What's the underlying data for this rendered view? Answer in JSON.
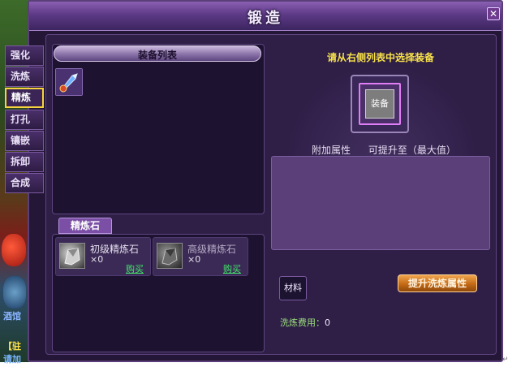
{
  "window": {
    "title": "锻造",
    "close_icon": "close-icon"
  },
  "tabs": [
    {
      "label": "强化",
      "active": false
    },
    {
      "label": "洗炼",
      "active": false
    },
    {
      "label": "精炼",
      "active": true
    },
    {
      "label": "打孔",
      "active": false
    },
    {
      "label": "镶嵌",
      "active": false
    },
    {
      "label": "拆卸",
      "active": false
    },
    {
      "label": "合成",
      "active": false
    }
  ],
  "equipment_list": {
    "header": "装备列表",
    "items": [
      {
        "icon": "blue-gem-tool-icon"
      }
    ]
  },
  "refine_stones": {
    "tab_label": "精炼石",
    "items": [
      {
        "name": "初级精炼石",
        "count": "×0",
        "buy_label": "购买"
      },
      {
        "name": "高级精炼石",
        "count": "×0",
        "buy_label": "购买"
      }
    ]
  },
  "right_panel": {
    "hint": "请从右侧列表中选择装备",
    "equip_slot_label": "装备",
    "attr_label": "附加属性",
    "attr_max_label": "可提升至（最大值）",
    "material_label": "材料",
    "upgrade_button": "提升洗炼属性",
    "fee_label": "洗炼费用：",
    "fee_value": "0"
  },
  "backdrop": {
    "text1": "酒馆",
    "text2": "【驻",
    "text3": "请加"
  },
  "colors": {
    "accent": "#f7d33d",
    "buy_link": "#42e86a",
    "fee": "#9adf7a",
    "hint": "#f8e24a"
  }
}
